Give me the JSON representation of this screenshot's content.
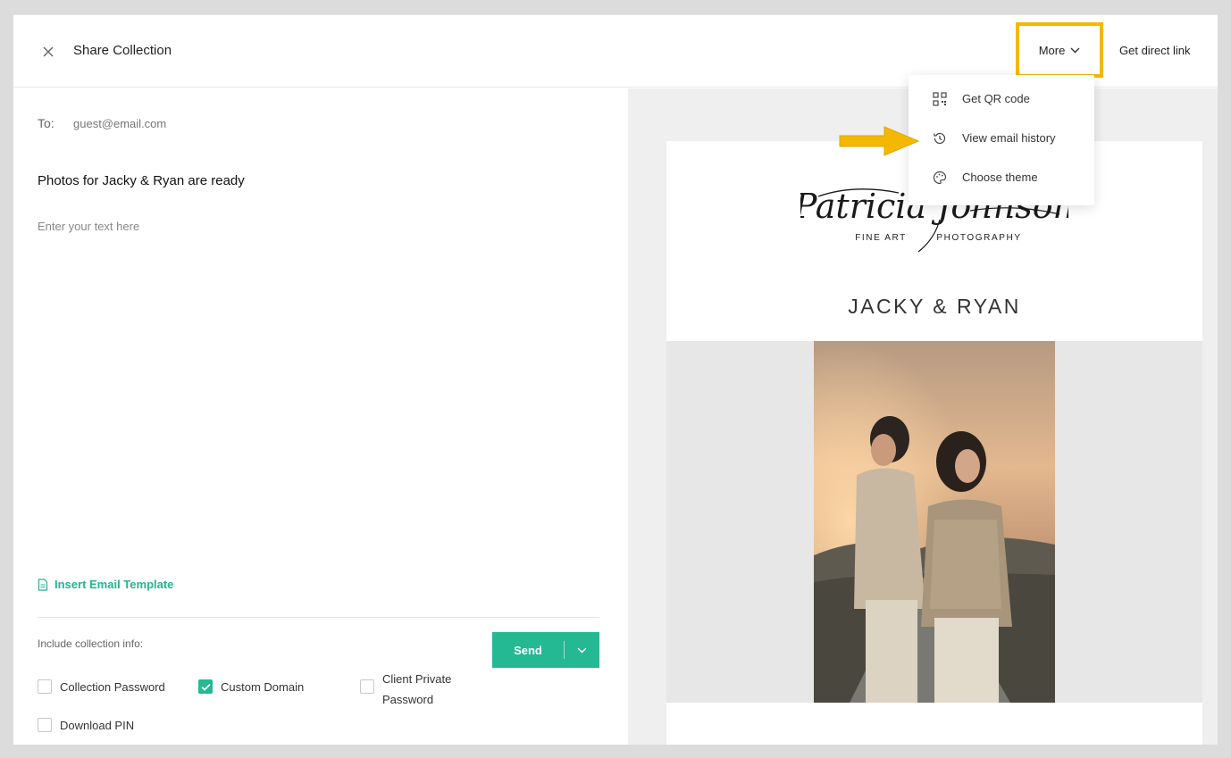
{
  "header": {
    "title": "Share Collection",
    "more_label": "More",
    "direct_link_label": "Get direct link"
  },
  "compose": {
    "to_label": "To:",
    "to_value": "guest@email.com",
    "subject": "Photos for Jacky & Ryan are ready",
    "body_placeholder": "Enter your text here",
    "insert_template_label": "Insert Email Template",
    "include_label": "Include collection info:",
    "send_label": "Send",
    "options": [
      {
        "label": "Collection Password",
        "checked": false
      },
      {
        "label": "Custom Domain",
        "checked": true
      },
      {
        "label": "Client Private Password",
        "checked": false
      },
      {
        "label": "Download PIN",
        "checked": false
      }
    ]
  },
  "preview": {
    "brand_script": "Patricia Johnson",
    "brand_sub_left": "FINE ART",
    "brand_sub_right": "PHOTOGRAPHY",
    "couple_name": "JACKY & RYAN"
  },
  "more_menu": {
    "items": [
      {
        "label": "Get QR code",
        "icon": "qr-code-icon"
      },
      {
        "label": "View email history",
        "icon": "history-icon"
      },
      {
        "label": "Choose theme",
        "icon": "palette-icon"
      }
    ]
  },
  "colors": {
    "accent": "#24b893",
    "highlight": "#f5b800",
    "preview_bg": "#f0efef"
  }
}
